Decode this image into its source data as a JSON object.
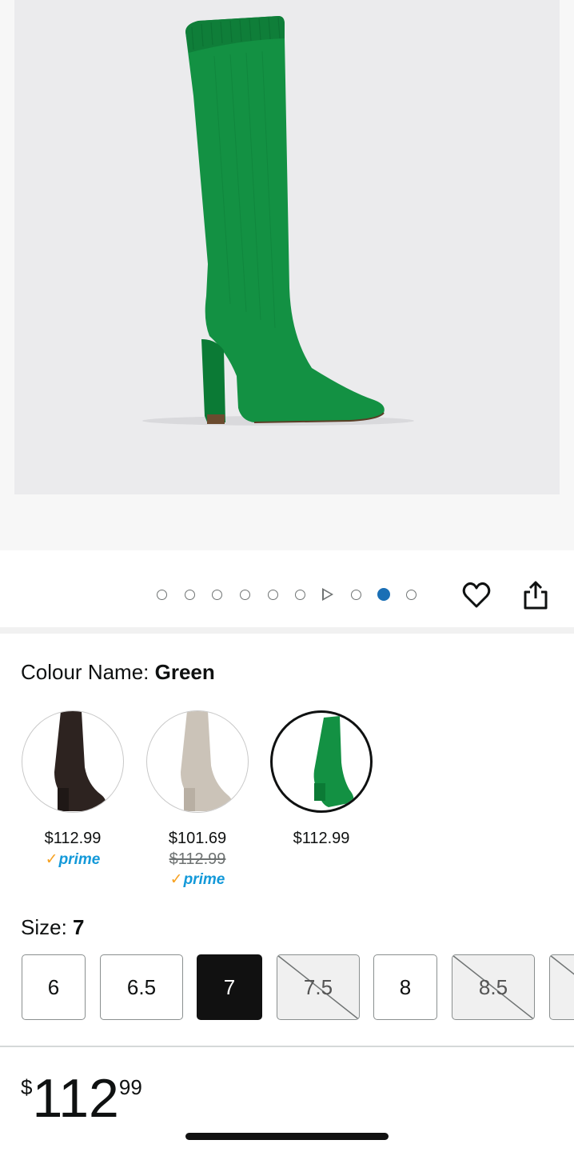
{
  "gallery": {
    "dot_count": 10,
    "active_index": 8,
    "video_index": 6
  },
  "colour": {
    "label": "Colour Name: ",
    "selected": "Green",
    "options": [
      {
        "name": "brown",
        "color": "#2d2320",
        "price": "$112.99",
        "prime": "prime"
      },
      {
        "name": "beige",
        "color": "#cbc3b8",
        "price": "$101.69",
        "was": "$112.99",
        "prime": "prime"
      },
      {
        "name": "green",
        "color": "#0f8a3a",
        "price": "$112.99"
      }
    ]
  },
  "size": {
    "label": "Size: ",
    "selected": "7",
    "options": [
      "6",
      "6.5",
      "7",
      "7.5",
      "8",
      "8.5"
    ]
  },
  "price": {
    "currency": "$",
    "whole": "112",
    "fraction": "99"
  },
  "colors": {
    "accent_blue": "#1a6fb5",
    "prime_blue": "#1399d9",
    "prime_check": "#f7a120",
    "boot_green": "#0f8a3a"
  }
}
